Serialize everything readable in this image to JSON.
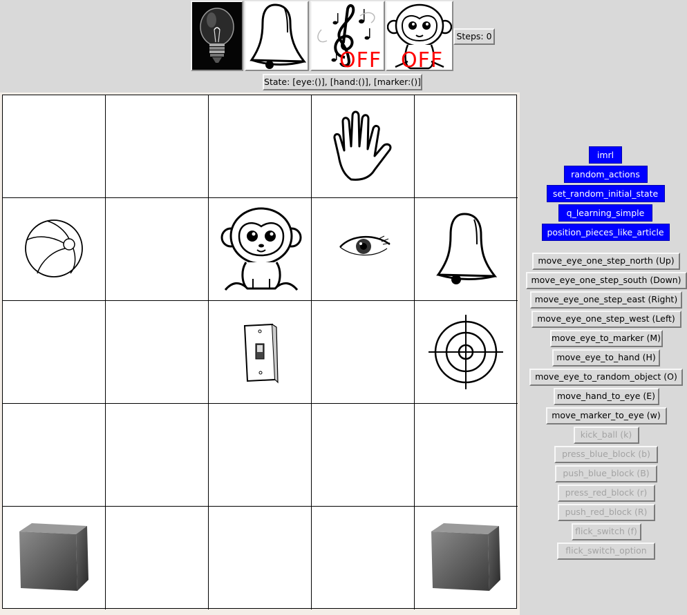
{
  "toolbar": {
    "indicators": [
      {
        "name": "light",
        "icon": "light-bulb-icon",
        "status": "on"
      },
      {
        "name": "bell",
        "icon": "bell-icon",
        "status": "ringing"
      },
      {
        "name": "music",
        "icon": "music-note-icon",
        "status": "OFF"
      },
      {
        "name": "monkey",
        "icon": "monkey-icon",
        "status": "OFF"
      }
    ],
    "steps_label": "Steps: 0",
    "state_label": "State: [eye:()], [hand:()], [marker:()]"
  },
  "board": {
    "rows": 5,
    "cols": 5,
    "pieces": [
      {
        "name": "hand",
        "icon": "hand-icon",
        "row": 0,
        "col": 3
      },
      {
        "name": "ball",
        "icon": "ball-icon",
        "row": 1,
        "col": 0
      },
      {
        "name": "monkey",
        "icon": "monkey-icon",
        "row": 1,
        "col": 2
      },
      {
        "name": "eye",
        "icon": "eye-icon",
        "row": 1,
        "col": 3
      },
      {
        "name": "bell",
        "icon": "bell-icon",
        "row": 1,
        "col": 4
      },
      {
        "name": "switch",
        "icon": "light-switch-icon",
        "row": 2,
        "col": 2
      },
      {
        "name": "marker",
        "icon": "target-marker-icon",
        "row": 2,
        "col": 4
      },
      {
        "name": "block",
        "icon": "block-icon",
        "row": 4,
        "col": 0
      },
      {
        "name": "block",
        "icon": "block-icon",
        "row": 4,
        "col": 4
      }
    ]
  },
  "algorithms": [
    "imrl",
    "random_actions",
    "set_random_initial_state",
    "q_learning_simple",
    "position_pieces_like_article"
  ],
  "actions": [
    {
      "label": "move_eye_one_step_north (Up)",
      "enabled": true
    },
    {
      "label": "move_eye_one_step_south (Down)",
      "enabled": true
    },
    {
      "label": "move_eye_one_step_east (Right)",
      "enabled": true
    },
    {
      "label": "move_eye_one_step_west (Left)",
      "enabled": true
    },
    {
      "label": "move_eye_to_marker (M)",
      "enabled": true
    },
    {
      "label": "move_eye_to_hand (H)",
      "enabled": true
    },
    {
      "label": "move_eye_to_random_object (O)",
      "enabled": true
    },
    {
      "label": "move_hand_to_eye (E)",
      "enabled": true
    },
    {
      "label": "move_marker_to_eye (w)",
      "enabled": true
    },
    {
      "label": "kick_ball (k)",
      "enabled": false
    },
    {
      "label": "press_blue_block (b)",
      "enabled": false
    },
    {
      "label": "push_blue_block (B)",
      "enabled": false
    },
    {
      "label": "press_red_block (r)",
      "enabled": false
    },
    {
      "label": "push_red_block (R)",
      "enabled": false
    },
    {
      "label": "flick_switch (f)",
      "enabled": false
    },
    {
      "label": "flick_switch_option",
      "enabled": false
    }
  ]
}
